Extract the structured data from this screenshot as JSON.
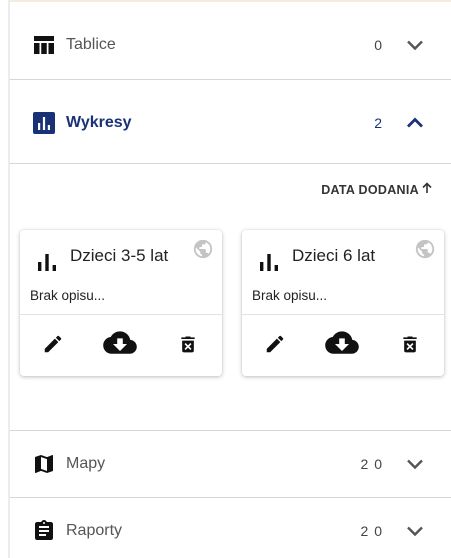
{
  "colors": {
    "accent": "#1a3178",
    "icon_dark": "#111111",
    "globe": "#c4c4c4"
  },
  "sections": [
    {
      "key": "tables",
      "label": "Tablice",
      "count": "0",
      "icon": "table-icon",
      "expanded": false
    },
    {
      "key": "charts",
      "label": "Wykresy",
      "count": "2",
      "icon": "bar-chart-icon",
      "expanded": true
    },
    {
      "key": "maps",
      "label": "Mapy",
      "count": "2 0",
      "icon": "map-icon",
      "expanded": false
    },
    {
      "key": "reports",
      "label": "Raporty",
      "count": "2 0",
      "icon": "clipboard-icon",
      "expanded": false
    }
  ],
  "charts_panel": {
    "sort_label": "DATA DODANIA",
    "sort_icon": "arrow-up-icon",
    "cards": [
      {
        "title": "Dzieci 3-5 lat",
        "description": "Brak opisu...",
        "icon": "bar-chart-icon",
        "status_icon": "globe-icon",
        "actions": [
          "edit-icon",
          "cloud-download-icon",
          "delete-icon"
        ]
      },
      {
        "title": "Dzieci 6 lat",
        "description": "Brak opisu...",
        "icon": "bar-chart-icon",
        "status_icon": "globe-icon",
        "actions": [
          "edit-icon",
          "cloud-download-icon",
          "delete-icon"
        ]
      }
    ]
  }
}
